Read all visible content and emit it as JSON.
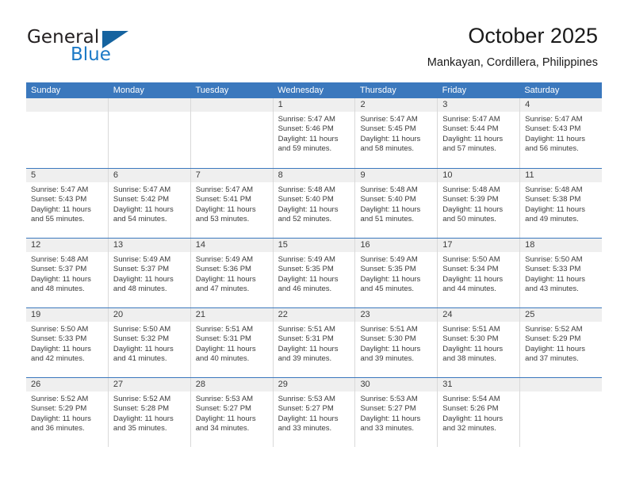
{
  "brand": {
    "name_part1": "General",
    "name_part2": "Blue"
  },
  "header": {
    "title": "October 2025",
    "location": "Mankayan, Cordillera, Philippines"
  },
  "colors": {
    "header_blue": "#3b78bd",
    "brand_blue": "#1b79c6",
    "day_band_gray": "#efefef",
    "cell_border": "#d9d9d9"
  },
  "weekdays": [
    "Sunday",
    "Monday",
    "Tuesday",
    "Wednesday",
    "Thursday",
    "Friday",
    "Saturday"
  ],
  "weeks": [
    [
      {
        "day": "",
        "sunrise": "",
        "sunset": "",
        "daylight": "",
        "empty": true
      },
      {
        "day": "",
        "sunrise": "",
        "sunset": "",
        "daylight": "",
        "empty": true
      },
      {
        "day": "",
        "sunrise": "",
        "sunset": "",
        "daylight": "",
        "empty": true
      },
      {
        "day": "1",
        "sunrise": "Sunrise: 5:47 AM",
        "sunset": "Sunset: 5:46 PM",
        "daylight": "Daylight: 11 hours and 59 minutes."
      },
      {
        "day": "2",
        "sunrise": "Sunrise: 5:47 AM",
        "sunset": "Sunset: 5:45 PM",
        "daylight": "Daylight: 11 hours and 58 minutes."
      },
      {
        "day": "3",
        "sunrise": "Sunrise: 5:47 AM",
        "sunset": "Sunset: 5:44 PM",
        "daylight": "Daylight: 11 hours and 57 minutes."
      },
      {
        "day": "4",
        "sunrise": "Sunrise: 5:47 AM",
        "sunset": "Sunset: 5:43 PM",
        "daylight": "Daylight: 11 hours and 56 minutes."
      }
    ],
    [
      {
        "day": "5",
        "sunrise": "Sunrise: 5:47 AM",
        "sunset": "Sunset: 5:43 PM",
        "daylight": "Daylight: 11 hours and 55 minutes."
      },
      {
        "day": "6",
        "sunrise": "Sunrise: 5:47 AM",
        "sunset": "Sunset: 5:42 PM",
        "daylight": "Daylight: 11 hours and 54 minutes."
      },
      {
        "day": "7",
        "sunrise": "Sunrise: 5:47 AM",
        "sunset": "Sunset: 5:41 PM",
        "daylight": "Daylight: 11 hours and 53 minutes."
      },
      {
        "day": "8",
        "sunrise": "Sunrise: 5:48 AM",
        "sunset": "Sunset: 5:40 PM",
        "daylight": "Daylight: 11 hours and 52 minutes."
      },
      {
        "day": "9",
        "sunrise": "Sunrise: 5:48 AM",
        "sunset": "Sunset: 5:40 PM",
        "daylight": "Daylight: 11 hours and 51 minutes."
      },
      {
        "day": "10",
        "sunrise": "Sunrise: 5:48 AM",
        "sunset": "Sunset: 5:39 PM",
        "daylight": "Daylight: 11 hours and 50 minutes."
      },
      {
        "day": "11",
        "sunrise": "Sunrise: 5:48 AM",
        "sunset": "Sunset: 5:38 PM",
        "daylight": "Daylight: 11 hours and 49 minutes."
      }
    ],
    [
      {
        "day": "12",
        "sunrise": "Sunrise: 5:48 AM",
        "sunset": "Sunset: 5:37 PM",
        "daylight": "Daylight: 11 hours and 48 minutes."
      },
      {
        "day": "13",
        "sunrise": "Sunrise: 5:49 AM",
        "sunset": "Sunset: 5:37 PM",
        "daylight": "Daylight: 11 hours and 48 minutes."
      },
      {
        "day": "14",
        "sunrise": "Sunrise: 5:49 AM",
        "sunset": "Sunset: 5:36 PM",
        "daylight": "Daylight: 11 hours and 47 minutes."
      },
      {
        "day": "15",
        "sunrise": "Sunrise: 5:49 AM",
        "sunset": "Sunset: 5:35 PM",
        "daylight": "Daylight: 11 hours and 46 minutes."
      },
      {
        "day": "16",
        "sunrise": "Sunrise: 5:49 AM",
        "sunset": "Sunset: 5:35 PM",
        "daylight": "Daylight: 11 hours and 45 minutes."
      },
      {
        "day": "17",
        "sunrise": "Sunrise: 5:50 AM",
        "sunset": "Sunset: 5:34 PM",
        "daylight": "Daylight: 11 hours and 44 minutes."
      },
      {
        "day": "18",
        "sunrise": "Sunrise: 5:50 AM",
        "sunset": "Sunset: 5:33 PM",
        "daylight": "Daylight: 11 hours and 43 minutes."
      }
    ],
    [
      {
        "day": "19",
        "sunrise": "Sunrise: 5:50 AM",
        "sunset": "Sunset: 5:33 PM",
        "daylight": "Daylight: 11 hours and 42 minutes."
      },
      {
        "day": "20",
        "sunrise": "Sunrise: 5:50 AM",
        "sunset": "Sunset: 5:32 PM",
        "daylight": "Daylight: 11 hours and 41 minutes."
      },
      {
        "day": "21",
        "sunrise": "Sunrise: 5:51 AM",
        "sunset": "Sunset: 5:31 PM",
        "daylight": "Daylight: 11 hours and 40 minutes."
      },
      {
        "day": "22",
        "sunrise": "Sunrise: 5:51 AM",
        "sunset": "Sunset: 5:31 PM",
        "daylight": "Daylight: 11 hours and 39 minutes."
      },
      {
        "day": "23",
        "sunrise": "Sunrise: 5:51 AM",
        "sunset": "Sunset: 5:30 PM",
        "daylight": "Daylight: 11 hours and 39 minutes."
      },
      {
        "day": "24",
        "sunrise": "Sunrise: 5:51 AM",
        "sunset": "Sunset: 5:30 PM",
        "daylight": "Daylight: 11 hours and 38 minutes."
      },
      {
        "day": "25",
        "sunrise": "Sunrise: 5:52 AM",
        "sunset": "Sunset: 5:29 PM",
        "daylight": "Daylight: 11 hours and 37 minutes."
      }
    ],
    [
      {
        "day": "26",
        "sunrise": "Sunrise: 5:52 AM",
        "sunset": "Sunset: 5:29 PM",
        "daylight": "Daylight: 11 hours and 36 minutes."
      },
      {
        "day": "27",
        "sunrise": "Sunrise: 5:52 AM",
        "sunset": "Sunset: 5:28 PM",
        "daylight": "Daylight: 11 hours and 35 minutes."
      },
      {
        "day": "28",
        "sunrise": "Sunrise: 5:53 AM",
        "sunset": "Sunset: 5:27 PM",
        "daylight": "Daylight: 11 hours and 34 minutes."
      },
      {
        "day": "29",
        "sunrise": "Sunrise: 5:53 AM",
        "sunset": "Sunset: 5:27 PM",
        "daylight": "Daylight: 11 hours and 33 minutes."
      },
      {
        "day": "30",
        "sunrise": "Sunrise: 5:53 AM",
        "sunset": "Sunset: 5:27 PM",
        "daylight": "Daylight: 11 hours and 33 minutes."
      },
      {
        "day": "31",
        "sunrise": "Sunrise: 5:54 AM",
        "sunset": "Sunset: 5:26 PM",
        "daylight": "Daylight: 11 hours and 32 minutes."
      },
      {
        "day": "",
        "sunrise": "",
        "sunset": "",
        "daylight": "",
        "empty": true
      }
    ]
  ]
}
